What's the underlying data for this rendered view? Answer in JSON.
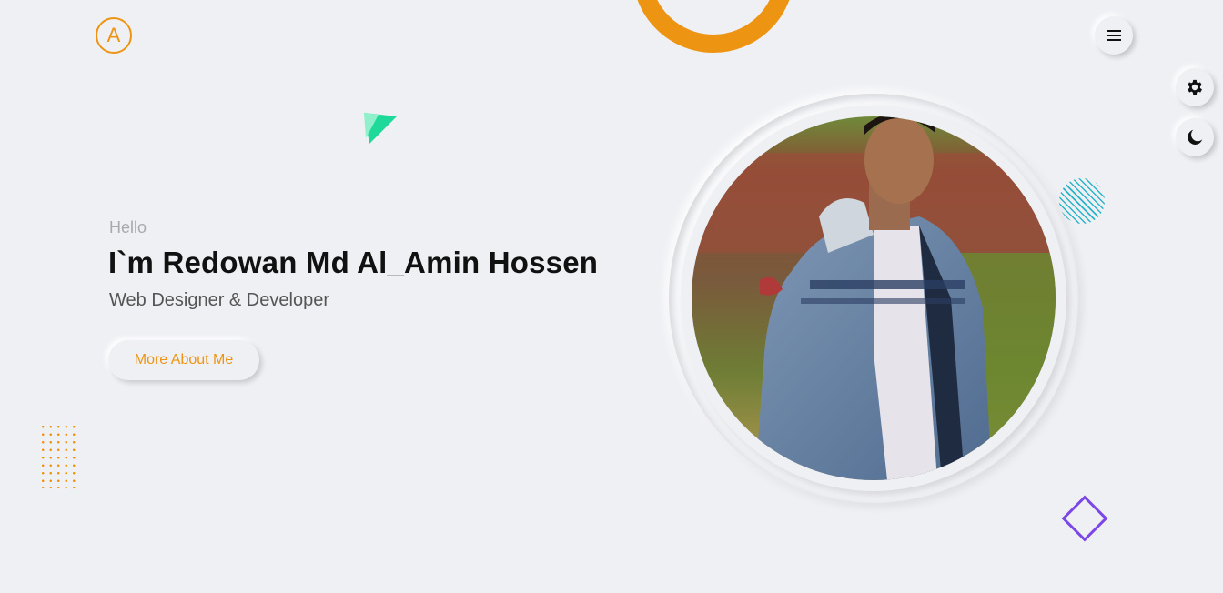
{
  "logo": {
    "letter": "A"
  },
  "hero": {
    "greeting": "Hello",
    "name": "I`m Redowan Md Al_Amin Hossen",
    "role": "Web Designer & Developer",
    "cta_label": "More About Me"
  },
  "icons": {
    "menu": "hamburger-menu-icon",
    "settings": "gear-icon",
    "theme": "moon-icon"
  },
  "colors": {
    "accent": "#ee9413",
    "background": "#eff0f4",
    "text_primary": "#111111",
    "text_secondary": "#555555",
    "teal": "#2bb5c9",
    "green": "#1ed99a",
    "purple": "#7d47e8"
  }
}
